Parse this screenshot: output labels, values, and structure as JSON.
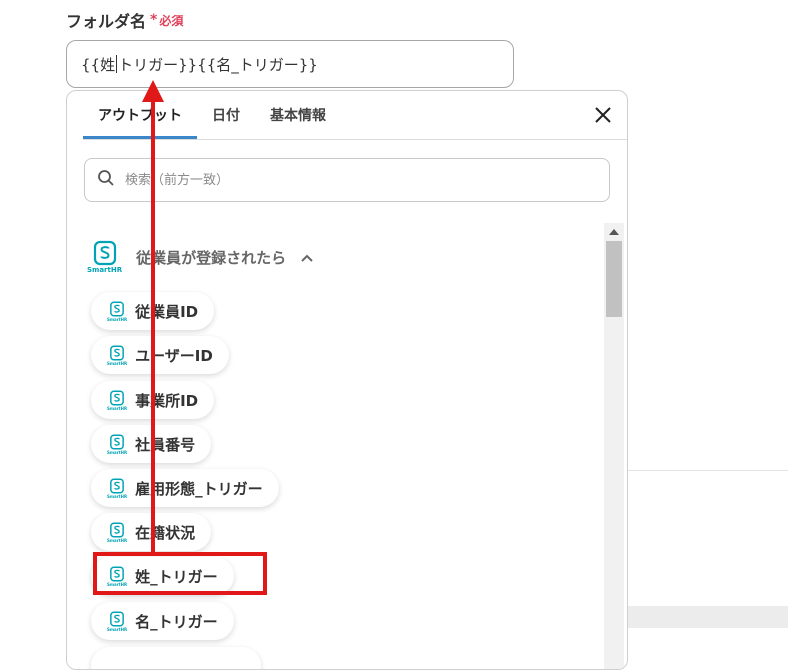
{
  "field": {
    "label": "フォルダ名",
    "required_mark": "*",
    "required_text": "必須",
    "value_before_caret": "{{姓",
    "value_after_caret": "トリガー}}{{名_トリガー}}"
  },
  "panel": {
    "tabs": [
      {
        "label": "アウトプット",
        "active": true
      },
      {
        "label": "日付",
        "active": false
      },
      {
        "label": "基本情報",
        "active": false
      }
    ],
    "search_placeholder": "検索（前方一致）",
    "group": {
      "logo_text": "SmartHR",
      "title": "従業員が登録されたら",
      "items": [
        {
          "label": "従業員ID",
          "highlighted": false
        },
        {
          "label": "ユーザーID",
          "highlighted": false
        },
        {
          "label": "事業所ID",
          "highlighted": false
        },
        {
          "label": "社員番号",
          "highlighted": false
        },
        {
          "label": "雇用形態_トリガー",
          "highlighted": false
        },
        {
          "label": "在籍状況",
          "highlighted": false
        },
        {
          "label": "姓_トリガー",
          "highlighted": true
        },
        {
          "label": "名_トリガー",
          "highlighted": false
        }
      ]
    }
  },
  "colors": {
    "accent_tab": "#3b86c8",
    "required": "#e0425b",
    "annotation_red": "#e01818",
    "smarthr_teal": "#00a3b5"
  }
}
